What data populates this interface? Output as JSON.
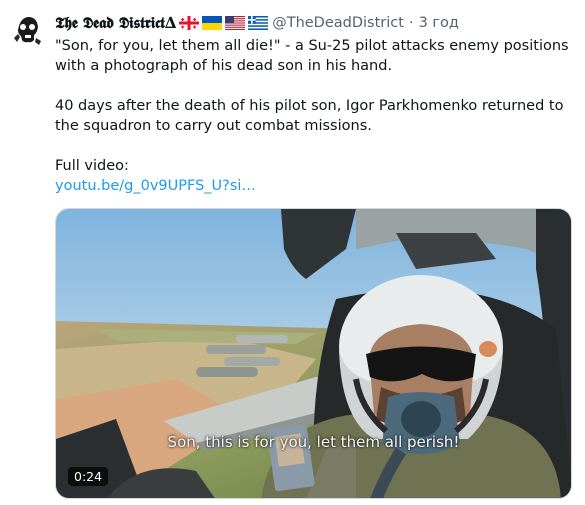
{
  "author": {
    "display_name": "𝕿𝖍𝖊 𝕯𝖊𝖆𝖉 𝕯𝖎𝖘𝖙𝖗𝖎𝖈𝖙∆",
    "flags": [
      "flag-georgia-icon",
      "flag-ukraine-icon",
      "flag-usa-icon",
      "flag-greece-icon"
    ],
    "handle": "@TheDeadDistrict",
    "separator": "·",
    "time": "3 год"
  },
  "tweet": {
    "line1": "\"Son, for you, let them all die!\" - a Su-25 pilot attacks enemy positions with a photograph of his dead son in his hand.",
    "line2": "40 days after the death of his pilot son, Igor Parkhomenko returned to the squadron to carry out combat missions.",
    "line3": "Full video:",
    "link": "youtu.be/g_0v9UPFS_U?si…"
  },
  "media": {
    "caption": "Son, this is for you, let them all perish!",
    "duration": "0:24"
  }
}
